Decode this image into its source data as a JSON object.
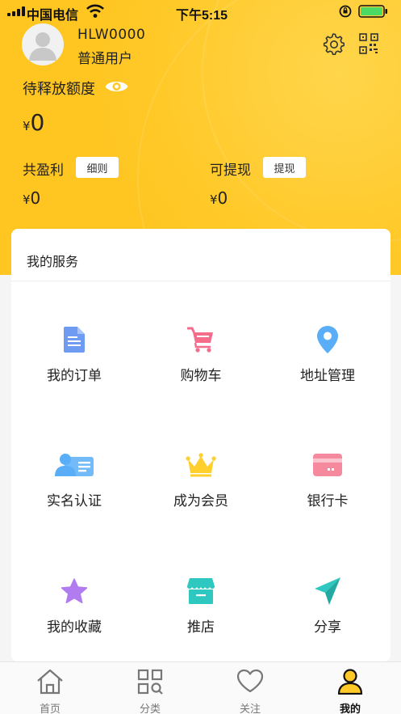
{
  "status_bar": {
    "carrier": "中国电信",
    "time": "下午5:15"
  },
  "profile": {
    "username": "HLW0000",
    "user_type": "普通用户"
  },
  "pending": {
    "label": "待释放额度",
    "currency": "¥",
    "value": "0"
  },
  "profit": {
    "label": "共盈利",
    "button": "细则",
    "currency": "¥",
    "value": "0"
  },
  "withdraw": {
    "label": "可提现",
    "button": "提现",
    "currency": "¥",
    "value": "0"
  },
  "services": {
    "title": "我的服务",
    "items": [
      {
        "label": "我的订单",
        "icon": "document-icon"
      },
      {
        "label": "购物车",
        "icon": "cart-icon"
      },
      {
        "label": "地址管理",
        "icon": "location-pin-icon"
      },
      {
        "label": "实名认证",
        "icon": "id-card-icon"
      },
      {
        "label": "成为会员",
        "icon": "crown-icon"
      },
      {
        "label": "银行卡",
        "icon": "bank-card-icon"
      },
      {
        "label": "我的收藏",
        "icon": "star-icon"
      },
      {
        "label": "推店",
        "icon": "store-icon"
      },
      {
        "label": "分享",
        "icon": "paper-plane-icon"
      }
    ]
  },
  "tabbar": {
    "tabs": [
      {
        "label": "首页",
        "icon": "home-icon"
      },
      {
        "label": "分类",
        "icon": "category-grid-icon"
      },
      {
        "label": "关注",
        "icon": "heart-icon"
      },
      {
        "label": "我的",
        "icon": "user-icon",
        "active": true
      }
    ]
  },
  "colors": {
    "header": "#ffc928",
    "accent_blue": "#6f9cf2",
    "accent_pink": "#f56d8a",
    "accent_sky": "#5aaef7",
    "accent_yellow": "#ffcf2e",
    "accent_purple": "#b07cf0",
    "accent_teal": "#2ec8c0"
  }
}
